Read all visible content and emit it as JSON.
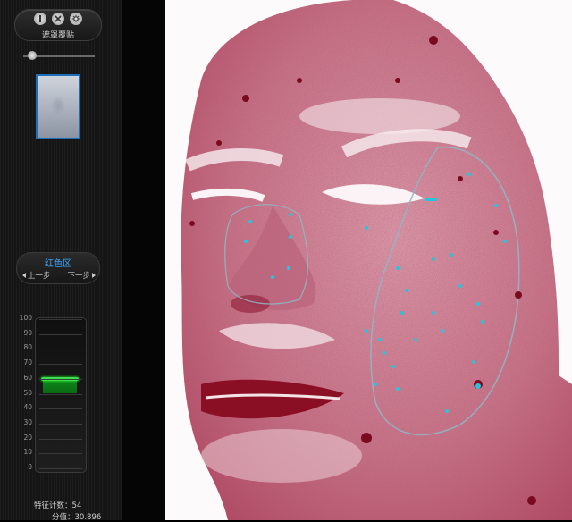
{
  "toolbar": {
    "mask_overlay_label": "遮罩覆贴",
    "buttons": [
      "opacity-icon",
      "close-icon",
      "settings-icon"
    ]
  },
  "opacity_slider": {
    "value": 0.1
  },
  "thumbnail": {
    "selected": true
  },
  "navigator": {
    "title": "红色区",
    "prev_label": "上一步",
    "next_label": "下一步"
  },
  "gauge": {
    "scale_labels": [
      "100",
      "90",
      "80",
      "70",
      "60",
      "50",
      "40",
      "30",
      "20",
      "10",
      "0"
    ],
    "value": 60,
    "min": 0,
    "max": 100
  },
  "stats": {
    "feature_count_label": "特征计数：",
    "feature_count": "54",
    "score_label": "分值：",
    "score": "30.896"
  },
  "colors": {
    "accent": "#3fa7ff",
    "gauge_fill": "#10891c",
    "marker": "#29c4dc",
    "skin_red": "#a3203a"
  }
}
